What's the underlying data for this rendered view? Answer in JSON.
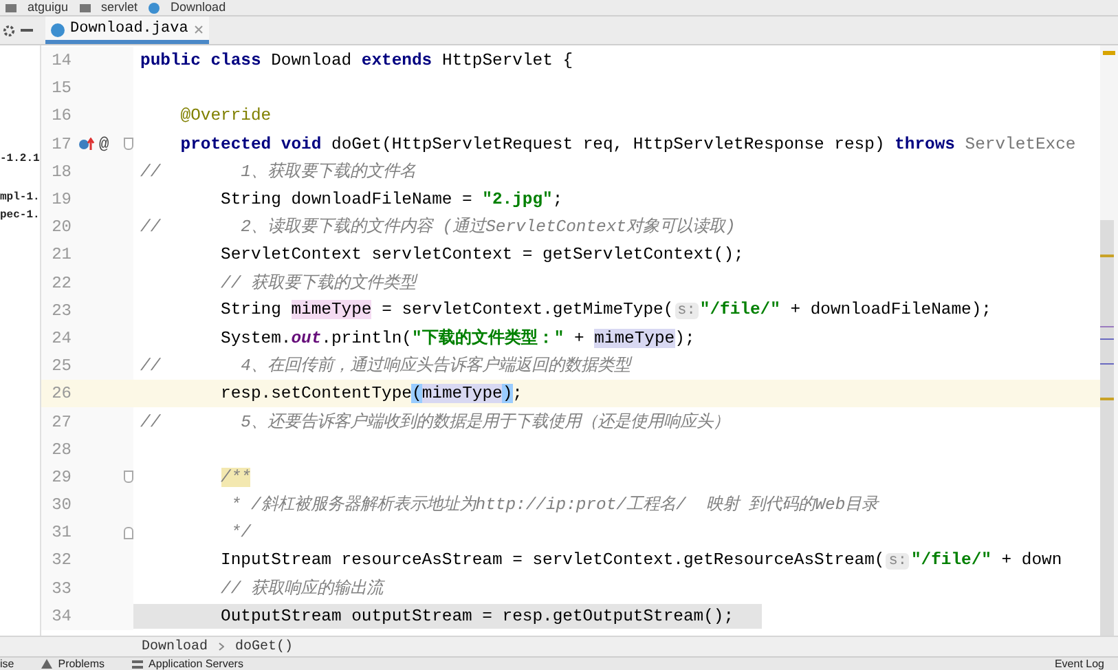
{
  "breadcrumb_top": [
    {
      "label": "atguigu",
      "kind": "folder"
    },
    {
      "label": "servlet",
      "kind": "folder"
    },
    {
      "label": "Download",
      "kind": "class"
    }
  ],
  "tabs": [
    {
      "label": "Download.java",
      "selected": true
    }
  ],
  "sidebar": {
    "items": [
      "-1.2.1",
      "mpl-1.",
      "pec-1."
    ]
  },
  "lines": [
    {
      "number": "14",
      "tokens": [
        {
          "kind": "keyword",
          "text": "public class"
        },
        {
          "kind": "plain",
          "text": " Download "
        },
        {
          "kind": "keyword",
          "text": "extends"
        },
        {
          "kind": "plain",
          "text": " HttpServlet {"
        }
      ]
    },
    {
      "number": "15"
    },
    {
      "number": "16",
      "tokens": [
        {
          "kind": "annotation",
          "text": "    @Override"
        }
      ]
    },
    {
      "number": "17",
      "overrides": true,
      "gutter_label": "@",
      "fold_start": true,
      "tokens": [
        {
          "kind": "keyword",
          "text": "    protected void"
        },
        {
          "kind": "plain",
          "text": " doGet(HttpServletRequest req, HttpServletResponse resp) "
        },
        {
          "kind": "keyword",
          "text": "throws"
        },
        {
          "kind": "dim",
          "text": " ServletExce"
        }
      ]
    },
    {
      "number": "18",
      "tokens": [
        {
          "kind": "comment",
          "text": "//        1、获取要下载的文件名"
        }
      ]
    },
    {
      "number": "19",
      "tokens": [
        {
          "kind": "plain",
          "text": "        String downloadFileName = "
        },
        {
          "kind": "string",
          "text": "\"2.jpg\""
        },
        {
          "kind": "plain",
          "text": ";"
        }
      ]
    },
    {
      "number": "20",
      "tokens": [
        {
          "kind": "comment",
          "text": "//        2、读取要下载的文件内容 (通过ServletContext对象可以读取)"
        }
      ]
    },
    {
      "number": "21",
      "tokens": [
        {
          "kind": "plain",
          "text": "        ServletContext servletContext = getServletContext();"
        }
      ]
    },
    {
      "number": "22",
      "tokens": [
        {
          "kind": "comment",
          "text": "        // 获取要下载的文件类型"
        }
      ]
    },
    {
      "number": "23",
      "tokens": [
        {
          "kind": "plain",
          "text": "        String "
        },
        {
          "kind": "write",
          "text": "mimeType"
        },
        {
          "kind": "plain",
          "text": " = servletContext.getMimeType("
        },
        {
          "kind": "hint",
          "text": "s:"
        },
        {
          "kind": "string",
          "text": "\"/file/\""
        },
        {
          "kind": "plain",
          "text": " + downloadFileName);"
        }
      ]
    },
    {
      "number": "24",
      "tokens": [
        {
          "kind": "plain",
          "text": "        System."
        },
        {
          "kind": "static",
          "text": "out"
        },
        {
          "kind": "plain",
          "text": ".println("
        },
        {
          "kind": "string",
          "text": "\"下载的文件类型：\""
        },
        {
          "kind": "plain",
          "text": " + "
        },
        {
          "kind": "read",
          "text": "mimeType"
        },
        {
          "kind": "plain",
          "text": ");"
        }
      ]
    },
    {
      "number": "25",
      "tokens": [
        {
          "kind": "comment",
          "text": "//        4、在回传前，通过响应头告诉客户端返回的数据类型"
        }
      ]
    },
    {
      "number": "26",
      "current": true,
      "tokens": [
        {
          "kind": "plain",
          "text": "        resp.setContentType"
        },
        {
          "kind": "match",
          "text": "("
        },
        {
          "kind": "read",
          "text": "mimeType"
        },
        {
          "kind": "match",
          "text": ")"
        },
        {
          "kind": "plain",
          "text": ";"
        }
      ]
    },
    {
      "number": "27",
      "tokens": [
        {
          "kind": "comment",
          "text": "//        5、还要告诉客户端收到的数据是用于下载使用（还是使用响应头）"
        }
      ]
    },
    {
      "number": "28"
    },
    {
      "number": "29",
      "fold_start": true,
      "tokens": [
        {
          "kind": "docmark",
          "text": "        /**"
        }
      ]
    },
    {
      "number": "30",
      "tokens": [
        {
          "kind": "doc",
          "text": "         * /斜杠被服务器解析表示地址为http://ip:prot/工程名/  映射 到代码的Web目录"
        }
      ]
    },
    {
      "number": "31",
      "fold_end": true,
      "tokens": [
        {
          "kind": "doc",
          "text": "         */"
        }
      ]
    },
    {
      "number": "32",
      "tokens": [
        {
          "kind": "plain",
          "text": "        InputStream resourceAsStream = servletContext.getResourceAsStream("
        },
        {
          "kind": "hint",
          "text": "s:"
        },
        {
          "kind": "string",
          "text": "\"/file/\""
        },
        {
          "kind": "plain",
          "text": " + down"
        }
      ]
    },
    {
      "number": "33",
      "tokens": [
        {
          "kind": "comment",
          "text": "        // 获取响应的输出流"
        }
      ]
    },
    {
      "number": "34",
      "tokens": [
        {
          "kind": "plain",
          "text": "        OutputStream outputStream = resp.getOutputStream();"
        }
      ]
    }
  ],
  "breadcrumb_bottom": [
    "Download",
    "doGet()"
  ],
  "status_bar": [
    {
      "label": "ise",
      "kind": "plain"
    },
    {
      "label": "Problems",
      "kind": "warning"
    },
    {
      "label": "Application Servers",
      "kind": "servers"
    },
    {
      "label": "Event Log",
      "kind": "plain"
    }
  ]
}
